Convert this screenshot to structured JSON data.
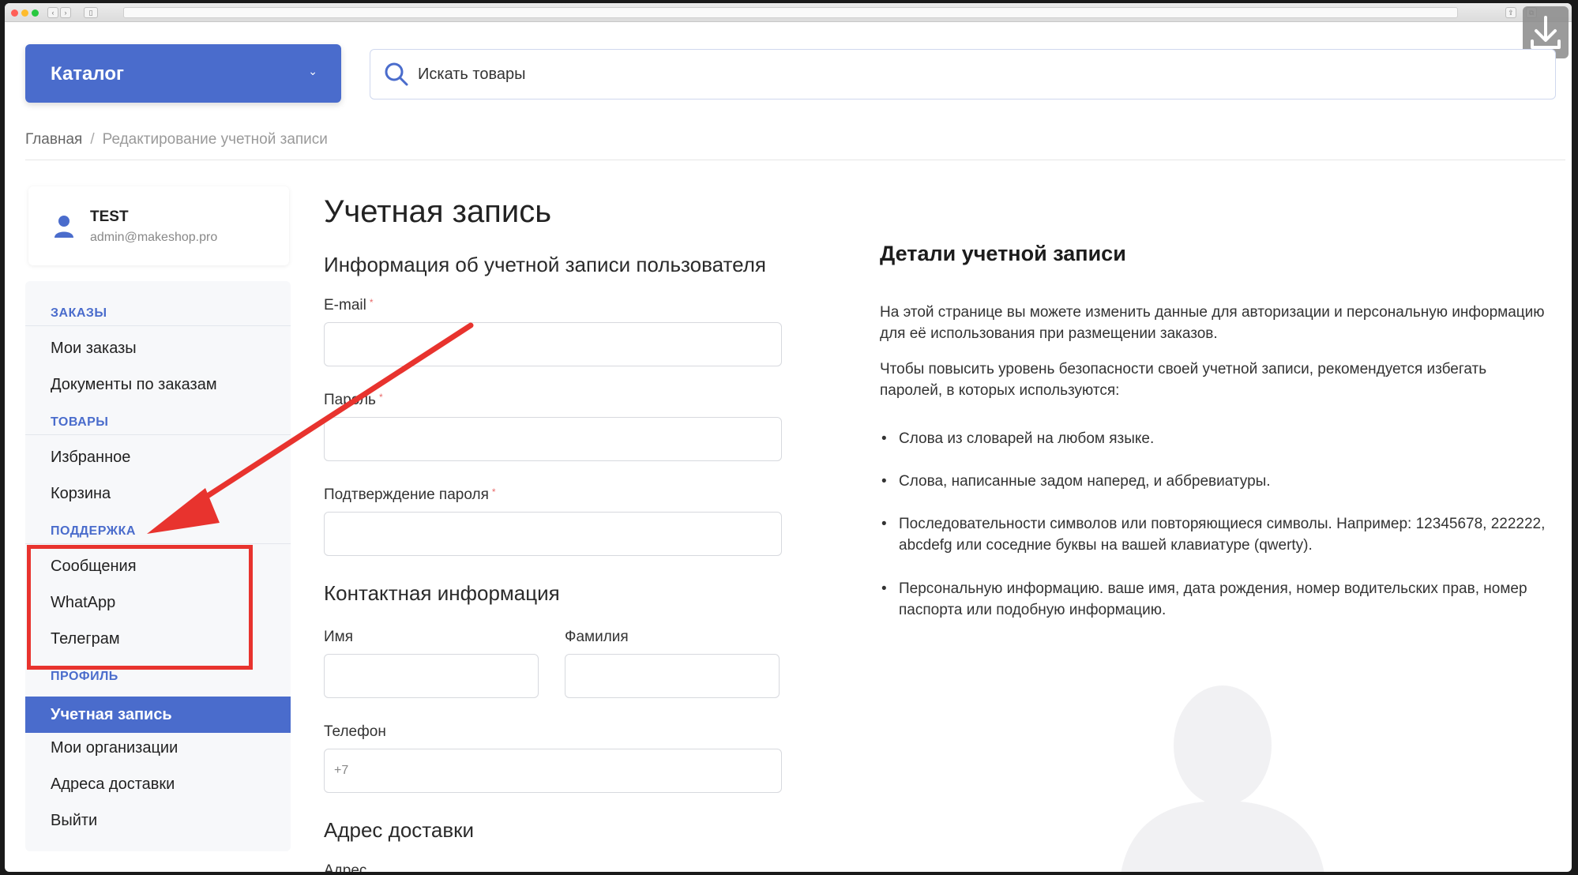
{
  "header": {
    "catalog_label": "Каталог",
    "search_placeholder": "Искать товары"
  },
  "breadcrumb": {
    "home": "Главная",
    "separator": "/",
    "current": "Редактирование учетной записи"
  },
  "user": {
    "name": "TEST",
    "email": "admin@makeshop.pro"
  },
  "sidebar": {
    "sections": [
      {
        "title": "ЗАКАЗЫ",
        "items": [
          "Мои заказы",
          "Документы по заказам"
        ]
      },
      {
        "title": "ТОВАРЫ",
        "items": [
          "Избранное",
          "Корзина"
        ]
      },
      {
        "title": "ПОДДЕРЖКА",
        "items": [
          "Сообщения",
          "WhatApp",
          "Телеграм"
        ]
      },
      {
        "title": "ПРОФИЛЬ",
        "items": [
          "Учетная запись",
          "Мои организации",
          "Адреса доставки",
          "Выйти"
        ]
      }
    ],
    "active_item": "Учетная запись"
  },
  "form": {
    "page_title": "Учетная запись",
    "account_info_title": "Информация об учетной записи пользователя",
    "email_label": "E-mail",
    "password_label": "Пароль",
    "confirm_label": "Подтверждение пароля",
    "required_mark": "*",
    "contact_title": "Контактная информация",
    "first_name_label": "Имя",
    "last_name_label": "Фамилия",
    "phone_label": "Телефон",
    "phone_placeholder": "+7",
    "delivery_title": "Адрес доставки",
    "address_label": "Адрес"
  },
  "details": {
    "title": "Детали учетной записи",
    "para1": "На этой странице вы можете изменить данные для авторизации и персональную информацию для её использования при размещении заказов.",
    "para2": "Чтобы повысить уровень безопасности своей учетной записи, рекомендуется избегать паролей, в которых используются:",
    "bullets": [
      "Слова из словарей на любом языке.",
      "Слова, написанные задом наперед, и аббревиатуры.",
      "Последовательности символов или повторяющиеся символы. Например: 12345678, 222222, abcdefg или соседние буквы на вашей клавиатуре (qwerty).",
      "Персональную информацию. ваше имя, дата рождения, номер водительских прав, номер паспорта или подобную информацию."
    ],
    "bullet_char": "•"
  },
  "colors": {
    "accent": "#4a6ccc",
    "annotation": "#e8332e"
  }
}
